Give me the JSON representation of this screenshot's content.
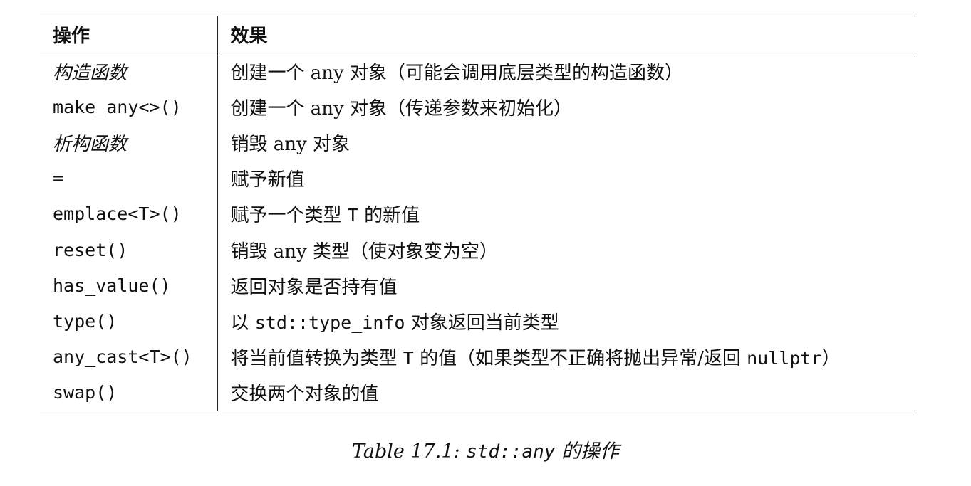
{
  "table": {
    "headers": [
      "操作",
      "效果"
    ],
    "rows": [
      {
        "op": "构造函数",
        "op_style": "italic",
        "effect": [
          {
            "t": "创建一个 any 对象（可能会调用底层类型的构造函数）"
          }
        ]
      },
      {
        "op": "make_any<>()",
        "op_style": "mono",
        "effect": [
          {
            "t": "创建一个 any 对象（传递参数来初始化）"
          }
        ]
      },
      {
        "op": "析构函数",
        "op_style": "italic",
        "effect": [
          {
            "t": "销毁 any 对象"
          }
        ]
      },
      {
        "op": "=",
        "op_style": "mono",
        "effect": [
          {
            "t": "赋予新值"
          }
        ]
      },
      {
        "op": "emplace<T>()",
        "op_style": "mono",
        "effect": [
          {
            "t": "赋予一个类型 "
          },
          {
            "t": "T",
            "code": true
          },
          {
            "t": " 的新值"
          }
        ]
      },
      {
        "op": "reset()",
        "op_style": "mono",
        "effect": [
          {
            "t": "销毁 any 类型（使对象变为空）"
          }
        ]
      },
      {
        "op": "has_value()",
        "op_style": "mono",
        "effect": [
          {
            "t": "返回对象是否持有值"
          }
        ]
      },
      {
        "op": "type()",
        "op_style": "mono",
        "effect": [
          {
            "t": "以 "
          },
          {
            "t": "std::type_info",
            "code": true
          },
          {
            "t": " 对象返回当前类型"
          }
        ]
      },
      {
        "op": "any_cast<T>()",
        "op_style": "mono",
        "effect": [
          {
            "t": "将当前值转换为类型 "
          },
          {
            "t": "T",
            "code": true
          },
          {
            "t": " 的值（如果类型不正确将抛出异常/返回 "
          },
          {
            "t": "nullptr",
            "code": true
          },
          {
            "t": "）"
          }
        ]
      },
      {
        "op": "swap()",
        "op_style": "mono",
        "effect": [
          {
            "t": "交换两个对象的值"
          }
        ]
      }
    ]
  },
  "caption": {
    "prefix": "Table 17.1: ",
    "code": "std::any",
    "suffix": " 的操作"
  }
}
